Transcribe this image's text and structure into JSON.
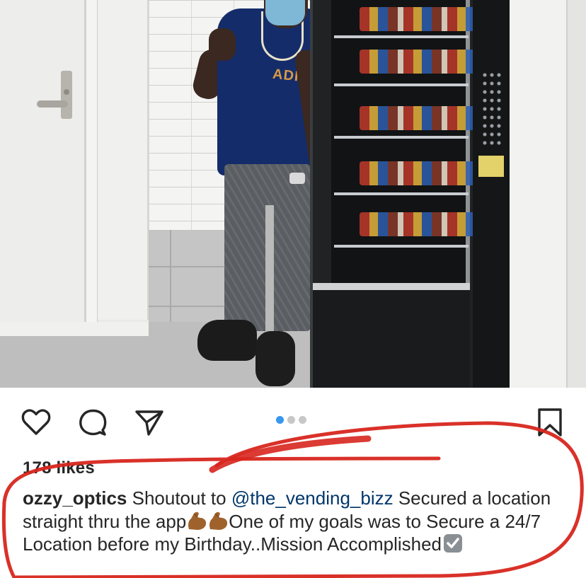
{
  "post": {
    "likes_text": "178 likes",
    "username": "ozzy_optics",
    "caption_part1": " Shoutout to ",
    "mention": "@the_vending_bizz",
    "caption_part2": " Secured a location straight thru the app",
    "caption_part3": "One of my goals was to Secure a 24/7 Location before my Birthday..Mission Accomplished",
    "emoji_names": [
      "flexed-biceps-emoji",
      "flexed-biceps-emoji",
      "check-mark-button-emoji"
    ]
  },
  "photo": {
    "shirt_text": "ADIDAS"
  },
  "carousel": {
    "total": 3,
    "active_index": 0
  },
  "icons": {
    "like": "heart-icon",
    "comment": "comment-bubble-icon",
    "share": "paper-plane-icon",
    "save": "bookmark-icon"
  },
  "colors": {
    "text": "#262626",
    "mention": "#00376b",
    "active_dot": "#3897f0",
    "inactive_dot": "#c7c7c7",
    "annotation": "#d7261e"
  }
}
